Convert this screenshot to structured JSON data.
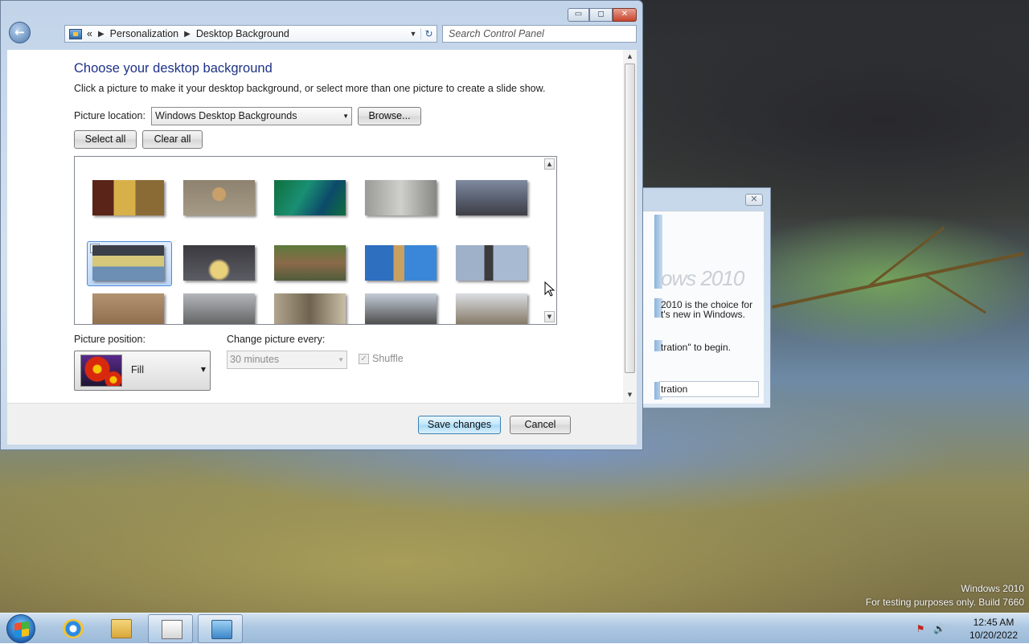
{
  "window": {
    "address": {
      "chevron": "«",
      "crumbs": [
        "Personalization",
        "Desktop Background"
      ],
      "dropdown_glyph": "▼",
      "refresh_glyph": "↻"
    },
    "search_placeholder": "Search Control Panel",
    "controls": {
      "minimize": "▭",
      "maximize": "◻",
      "close": "✕"
    }
  },
  "page": {
    "title": "Choose your desktop background",
    "description": "Click a picture to make it your desktop background, or select more than one picture to create a slide show.",
    "location_label": "Picture location:",
    "location_value": "Windows Desktop Backgrounds",
    "browse_label": "Browse...",
    "select_all_label": "Select all",
    "clear_all_label": "Clear all",
    "position_label": "Picture position:",
    "position_value": "Fill",
    "change_label": "Change picture every:",
    "change_value": "30 minutes",
    "shuffle_label": "Shuffle",
    "shuffle_checked": true,
    "selected_index": 5,
    "thumbnails_count": 15
  },
  "footer": {
    "save_label": "Save changes",
    "cancel_label": "Cancel"
  },
  "background_dialog": {
    "logo_fragment": "ows 2010",
    "line1": "2010 is the choice for",
    "line2": "t's new in Windows.",
    "line3": "tration\" to begin.",
    "field_value": "tration"
  },
  "desktop": {
    "watermark_line1": "Windows 2010",
    "watermark_line2": "For testing purposes only. Build 7660"
  },
  "taskbar": {
    "time": "12:45 AM",
    "date": "10/20/2022",
    "items": [
      "internet-explorer",
      "windows-explorer",
      "projector",
      "control-panel"
    ]
  },
  "colors": {
    "title_blue": "#1e3287",
    "selection_blue": "#4e8cd8",
    "close_red": "#c9442c"
  }
}
